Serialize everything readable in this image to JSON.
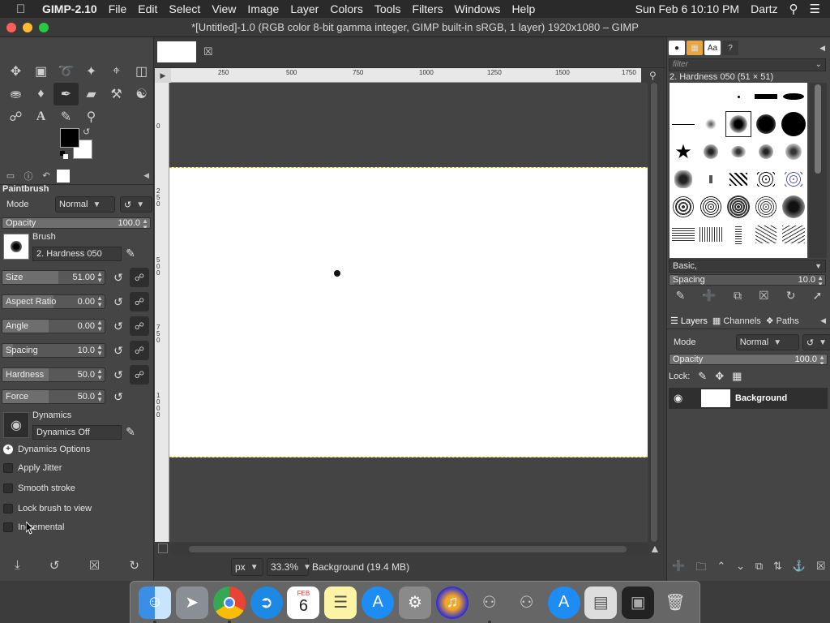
{
  "menubar": {
    "app_name": "GIMP-2.10",
    "menus": [
      "File",
      "Edit",
      "Select",
      "View",
      "Image",
      "Layer",
      "Colors",
      "Tools",
      "Filters",
      "Windows",
      "Help"
    ],
    "datetime": "Sun Feb 6  10:10 PM",
    "user": "Dartz"
  },
  "window": {
    "title": "*[Untitled]-1.0 (RGB color 8-bit gamma integer, GIMP built-in sRGB, 1 layer) 1920x1080 – GIMP"
  },
  "tool_options": {
    "title": "Paintbrush",
    "mode_label": "Mode",
    "mode_value": "Normal",
    "opacity": {
      "label": "Opacity",
      "value": "100.0",
      "fraction": 1.0
    },
    "brush_label": "Brush",
    "brush_value": "2. Hardness 050",
    "size": {
      "label": "Size",
      "value": "51.00",
      "fraction": 0.55
    },
    "aspect_ratio": {
      "label": "Aspect Ratio",
      "value": "0.00",
      "fraction": 0.5
    },
    "angle": {
      "label": "Angle",
      "value": "0.00",
      "fraction": 0.45
    },
    "spacing": {
      "label": "Spacing",
      "value": "10.0",
      "fraction": 0.1
    },
    "hardness": {
      "label": "Hardness",
      "value": "50.0",
      "fraction": 0.45
    },
    "force": {
      "label": "Force",
      "value": "50.0",
      "fraction": 0.45
    },
    "dynamics_label": "Dynamics",
    "dynamics_value": "Dynamics Off",
    "dynamics_options": "Dynamics Options",
    "checks": [
      "Apply Jitter",
      "Smooth stroke",
      "Lock brush to view",
      "Incremental"
    ]
  },
  "rulers": {
    "h_labels": [
      "250",
      "500",
      "750",
      "1000",
      "1250",
      "1500",
      "1750"
    ],
    "v_labels": [
      "0",
      "250",
      "500",
      "750",
      "1000"
    ],
    "v_small": [
      "1",
      "2",
      "5",
      "0",
      "5",
      "0",
      "0",
      "7",
      "5",
      "0",
      "1",
      "0",
      "0",
      "0"
    ]
  },
  "status": {
    "unit": "px",
    "zoom": "33.3%",
    "info": "Background (19.4 MB)"
  },
  "brushes": {
    "filter_placeholder": "filter",
    "current": "2. Hardness 050 (51 × 51)",
    "category": "Basic,",
    "spacing_label": "Spacing",
    "spacing_value": "10.0"
  },
  "layers": {
    "tabs": [
      "Layers",
      "Channels",
      "Paths"
    ],
    "mode_label": "Mode",
    "mode_value": "Normal",
    "opacity_label": "Opacity",
    "opacity_value": "100.0",
    "lock_label": "Lock:",
    "layer_name": "Background"
  },
  "dock": {
    "calendar_month": "FEB",
    "calendar_day": "6"
  }
}
